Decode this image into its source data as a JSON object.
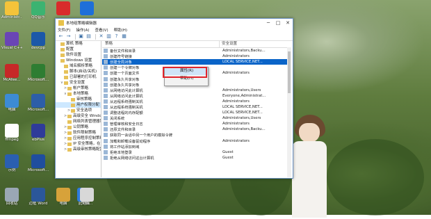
{
  "desktop": {
    "icons": [
      {
        "label": "Administr...",
        "color": "#f4c33a"
      },
      {
        "label": "QQ音乐",
        "color": "#3cb371"
      },
      {
        "label": "",
        "color": "#d92b2b"
      },
      {
        "label": "",
        "color": "#1e6fd9"
      },
      {
        "label": "Visual C++...",
        "color": "#6a45b5"
      },
      {
        "label": "devcpp",
        "color": "#1b58a8"
      },
      {
        "label": "McAfee...",
        "color": "#c62828"
      },
      {
        "label": "Microsoft...",
        "color": "#2e7d32"
      },
      {
        "label": "电脑",
        "color": "#3d8bd4"
      },
      {
        "label": "Microsoft...",
        "color": "#2d5ea8"
      },
      {
        "label": "ffmpeg",
        "color": "#ffffff"
      },
      {
        "label": "ebPlus",
        "color": "#2f3b99"
      },
      {
        "label": "示例",
        "color": "#2a5fb0"
      },
      {
        "label": "Microsoft...",
        "color": "#1f4e9e"
      },
      {
        "label": "回收站",
        "color": "#9aa7b5"
      },
      {
        "label": "边框 Word",
        "color": "#2b579a"
      },
      {
        "label": "电脑",
        "color": "#d7a23a"
      },
      {
        "label": "此电脑",
        "color": "#2d7be0"
      },
      {
        "label": "...",
        "color": "#4d73b8"
      },
      {
        "label": "文档...",
        "color": "#d8d8d8"
      }
    ]
  },
  "window": {
    "title": "本地组策略编辑器",
    "menu": [
      "文件(F)",
      "操作(A)",
      "查看(V)",
      "帮助(H)"
    ],
    "toolbar": [
      "←",
      "→",
      "▣",
      "▤",
      "✕",
      "▥",
      "?",
      "▦"
    ],
    "tree": [
      {
        "label": "算机 策略",
        "indent": 0,
        "ex": ""
      },
      {
        "label": "配置",
        "indent": 0,
        "ex": ""
      },
      {
        "label": "软件设置",
        "indent": 0,
        "ex": ""
      },
      {
        "label": "Windows 设置",
        "indent": 0,
        "ex": ""
      },
      {
        "label": "域名解析策略",
        "indent": 1,
        "ex": ""
      },
      {
        "label": "脚本(启动/关机)",
        "indent": 1,
        "ex": ""
      },
      {
        "label": "已部署的打印机",
        "indent": 1,
        "ex": ""
      },
      {
        "label": "安全设置",
        "indent": 1,
        "ex": "∨"
      },
      {
        "label": "帐户策略",
        "indent": 2,
        "ex": ">"
      },
      {
        "label": "本地策略",
        "indent": 2,
        "ex": "∨"
      },
      {
        "label": "审核策略",
        "indent": 3,
        "ex": ""
      },
      {
        "label": "用户权限分配",
        "indent": 3,
        "ex": "",
        "selected": true
      },
      {
        "label": "安全选项",
        "indent": 3,
        "ex": ">"
      },
      {
        "label": "高级安全 Windov",
        "indent": 2,
        "ex": ">"
      },
      {
        "label": "网络列表管理器策",
        "indent": 2,
        "ex": ""
      },
      {
        "label": "公钥策略",
        "indent": 2,
        "ex": ">"
      },
      {
        "label": "软件限制策略",
        "indent": 2,
        "ex": ">"
      },
      {
        "label": "应用程序控制策略",
        "indent": 2,
        "ex": ">"
      },
      {
        "label": "IP 安全策略，在",
        "indent": 2,
        "ex": ">"
      },
      {
        "label": "高级审核策略配置",
        "indent": 2,
        "ex": ">"
      }
    ],
    "columns": {
      "policy": "策略",
      "setting": "安全设置"
    },
    "policies": [
      {
        "name": "备份文件和目录",
        "value": "Administrators,Backu..."
      },
      {
        "name": "创建符号链接",
        "value": "Administrators"
      },
      {
        "name": "创建全局对象",
        "value": "LOCAL SERVICE,NET...",
        "selected": true
      },
      {
        "name": "创建一个令牌对象",
        "value": ""
      },
      {
        "name": "创建一个页面文件",
        "value": "Administrators"
      },
      {
        "name": "创建永久共享对象",
        "value": ""
      },
      {
        "name": "创建永久共享对象",
        "value": ""
      },
      {
        "name": "从网络访问此计算机",
        "value": "Administrators,Users"
      },
      {
        "name": "从网络访问此计算机",
        "value": "Everyone,Administrat..."
      },
      {
        "name": "从远程系统强制关机",
        "value": "Administrators"
      },
      {
        "name": "从远程系统强制关机",
        "value": "LOCAL SERVICE,NET..."
      },
      {
        "name": "调整进程的内存配额",
        "value": "LOCAL SERVICE,NET..."
      },
      {
        "name": "关闭系统",
        "value": "Administrators,Users"
      },
      {
        "name": "管理审核和安全日志",
        "value": "Administrators"
      },
      {
        "name": "还原文件和目录",
        "value": "Administrators,Backu..."
      },
      {
        "name": "获取同一会话中另一个用户的模拟令牌",
        "value": ""
      },
      {
        "name": "加载和卸载设备驱动程序",
        "value": "Administrators"
      },
      {
        "name": "将工作站添加到域",
        "value": ""
      },
      {
        "name": "拒绝本地登录",
        "value": "Guest"
      },
      {
        "name": "拒绝从网络访问这台计算机",
        "value": "Guest"
      }
    ],
    "context_menu": [
      {
        "label": "属性(R)",
        "highlighted": true
      },
      {
        "label": "帮助(H)",
        "highlighted": false
      }
    ]
  }
}
